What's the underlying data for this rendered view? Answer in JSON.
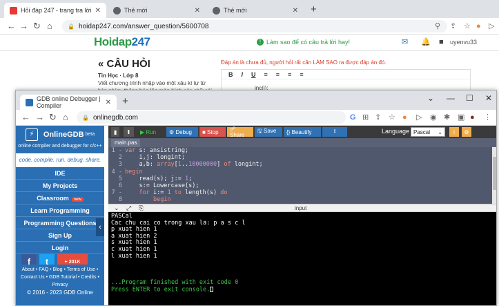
{
  "back_browser": {
    "tabs": [
      {
        "label": "Hỏi đáp 247 - trang tra lời",
        "favicon_color": "#e53935"
      },
      {
        "label": "Thẻ mới",
        "favicon_color": "#5f6368"
      },
      {
        "label": "Thẻ mới",
        "favicon_color": "#5f6368"
      }
    ],
    "new_tab": "+",
    "url": "hoidap247.com/answer_question/5600708"
  },
  "site": {
    "logo_a": "Hoidap",
    "logo_b": "247",
    "hint": "Làm sao để có câu trả lời hay!",
    "username": "uyenvu33",
    "question_title": "« CÂU HỎI",
    "question_subject": "Tin Học · Lớp 8",
    "question_body": "Viết chương trình nhập vào một xâu kí tự từ bàn phím, thông báo lên màn hình các chữ cái",
    "answer_note": "Đáp án là chưa đủ, người hỏi rất cần LÀM SAO ra được đáp án đó.",
    "editor_tools": [
      "B",
      "I",
      "U",
      "≡",
      "≡",
      "≡",
      "≡"
    ],
    "editor_text": "inc(j);"
  },
  "front_browser": {
    "tab": "GDB online Debugger | Compiler",
    "new_tab": "+",
    "url": "onlinegdb.com",
    "window_controls": [
      "⌄",
      "—",
      "☐",
      "✕"
    ]
  },
  "sidebar": {
    "brand": "OnlineGDB",
    "brand_sup": "beta",
    "tagline": "online compiler and debugger for c/c++",
    "slogan": "code. compile. run. debug. share.",
    "items": [
      "IDE",
      "My Projects",
      "Classroom",
      "Learn Programming",
      "Programming Questions",
      "Sign Up",
      "Login"
    ],
    "new_badge": "new",
    "social": [
      "f",
      "t",
      "+ 201K"
    ],
    "footer_lines": [
      "About • FAQ • Blog • Terms of Use •",
      "Contact Us • GDB Tutorial • Credits •",
      "Privacy"
    ],
    "copyright": "© 2016 - 2023 GDB Online"
  },
  "ide": {
    "buttons": [
      "▶ Run",
      "⚙ Debug",
      "■ Stop",
      "☍ Share",
      "🖫 Save",
      "{} Beautify",
      "⭳"
    ],
    "language_label": "Language",
    "language": "Pascal",
    "file_tab": "main.pas",
    "io_label": "input"
  },
  "code_lines": [
    {
      "n": "1",
      "html": "<span class='kw'>var</span> s: ansistring;"
    },
    {
      "n": "2",
      "html": "    i,j: longint;"
    },
    {
      "n": "3",
      "html": "    a,b: <span class='kw'>array</span>[<span class='num'>1</span>..<span class='num'>10000000</span>] <span class='kw'>of</span> longint;"
    },
    {
      "n": "4",
      "html": "<span class='kw'>begin</span>"
    },
    {
      "n": "5",
      "html": "    read(s); j:= <span class='num'>1</span>;"
    },
    {
      "n": "6",
      "html": "    s:= Lowercase(s);"
    },
    {
      "n": "7",
      "html": "    <span class='kw'>for</span> i:= <span class='num'>1</span> <span class='kw'>to</span> length(s) <span class='kw'>do</span>"
    },
    {
      "n": "8",
      "html": "        <span class='kw'>begin</span>"
    }
  ],
  "console_lines": [
    "PASCal",
    "Cac chu cai co trong xau la: p a s c l",
    "p xuat hien 1",
    "a xuat hien 2",
    "s xuat hien 1",
    "c xuat hien 1",
    "l xuat hien 1",
    "",
    "",
    "",
    "...Program finished with exit code 0",
    "Press ENTER to exit console."
  ]
}
